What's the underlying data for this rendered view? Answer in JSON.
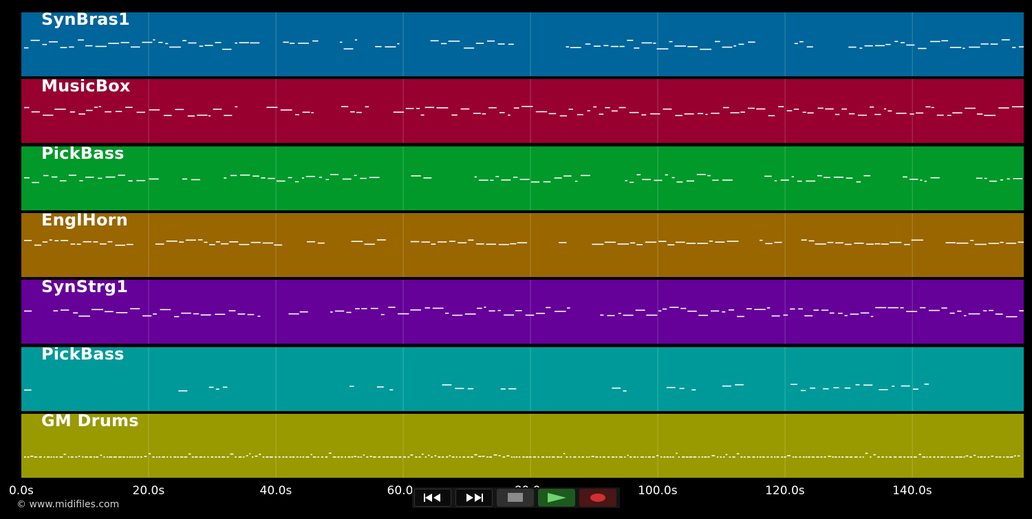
{
  "tracks": [
    {
      "name": "SynBras1",
      "color": "#00659a",
      "pattern": "melody"
    },
    {
      "name": "MusicBox",
      "color": "#980030",
      "pattern": "melody"
    },
    {
      "name": "PickBass",
      "color": "#00992a",
      "pattern": "bass"
    },
    {
      "name": "EnglHorn",
      "color": "#996600",
      "pattern": "phrase"
    },
    {
      "name": "SynStrg1",
      "color": "#650099",
      "pattern": "melody"
    },
    {
      "name": "PickBass",
      "color": "#009999",
      "pattern": "sparse"
    },
    {
      "name": "GM Drums",
      "color": "#999900",
      "pattern": "drums"
    }
  ],
  "timeline": {
    "ticks": [
      "0.0s",
      "20.0s",
      "40.0s",
      "60.0s",
      "80.0s",
      "100.0s",
      "120.0s",
      "140.0s"
    ],
    "tick_seconds": [
      0,
      20,
      40,
      60,
      80,
      100,
      120,
      140
    ],
    "visible_seconds": 157.5
  },
  "copyright": "© www.midifiles.com",
  "transport": {
    "rewind_icon": "rewind-icon",
    "forward_icon": "fast-forward-icon",
    "stop_icon": "stop-icon",
    "play_icon": "play-icon",
    "record_icon": "record-icon"
  }
}
